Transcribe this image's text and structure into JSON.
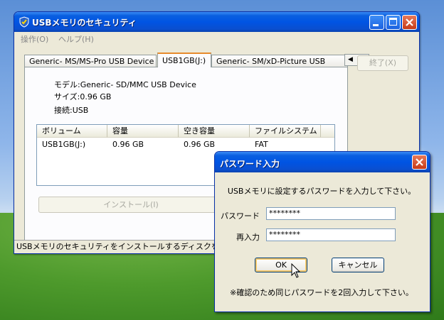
{
  "main_window": {
    "title": "USBメモリのセキュリティ",
    "menu": [
      "操作(O)",
      "ヘルプ(H)"
    ],
    "tabs": [
      {
        "label": "Generic- MS/MS-Pro USB Device",
        "active": false
      },
      {
        "label": "USB1GB(J:)",
        "active": true
      },
      {
        "label": "Generic- SM/xD-Picture USB",
        "active": false
      }
    ],
    "end_button": "終了(X)",
    "device_info": {
      "model": "モデル:Generic- SD/MMC USB Device",
      "size": "サイズ:0.96 GB",
      "connection": "接続:USB"
    },
    "volume_list": {
      "columns": [
        "ボリューム",
        "容量",
        "空き容量",
        "ファイルシステム"
      ],
      "rows": [
        [
          "USB1GB(J:)",
          "0.96 GB",
          "0.96 GB",
          "FAT"
        ]
      ]
    },
    "install_button": "インストール(I)",
    "status_text": "USBメモリのセキュリティをインストールするディスクを選択してください。"
  },
  "dialog": {
    "title": "パスワード入力",
    "message": "USBメモリに設定するパスワードを入力して下さい。",
    "password_label": "パスワード",
    "password_value": "********",
    "reenter_label": "再入力",
    "reenter_value": "********",
    "ok_label": "OK",
    "cancel_label": "キャンセル",
    "note": "※確認のため同じパスワードを2回入力して下さい。"
  },
  "colors": {
    "titlebar": "#0054e3",
    "close_button": "#c63a18",
    "tab_highlight": "#e68b2c"
  }
}
